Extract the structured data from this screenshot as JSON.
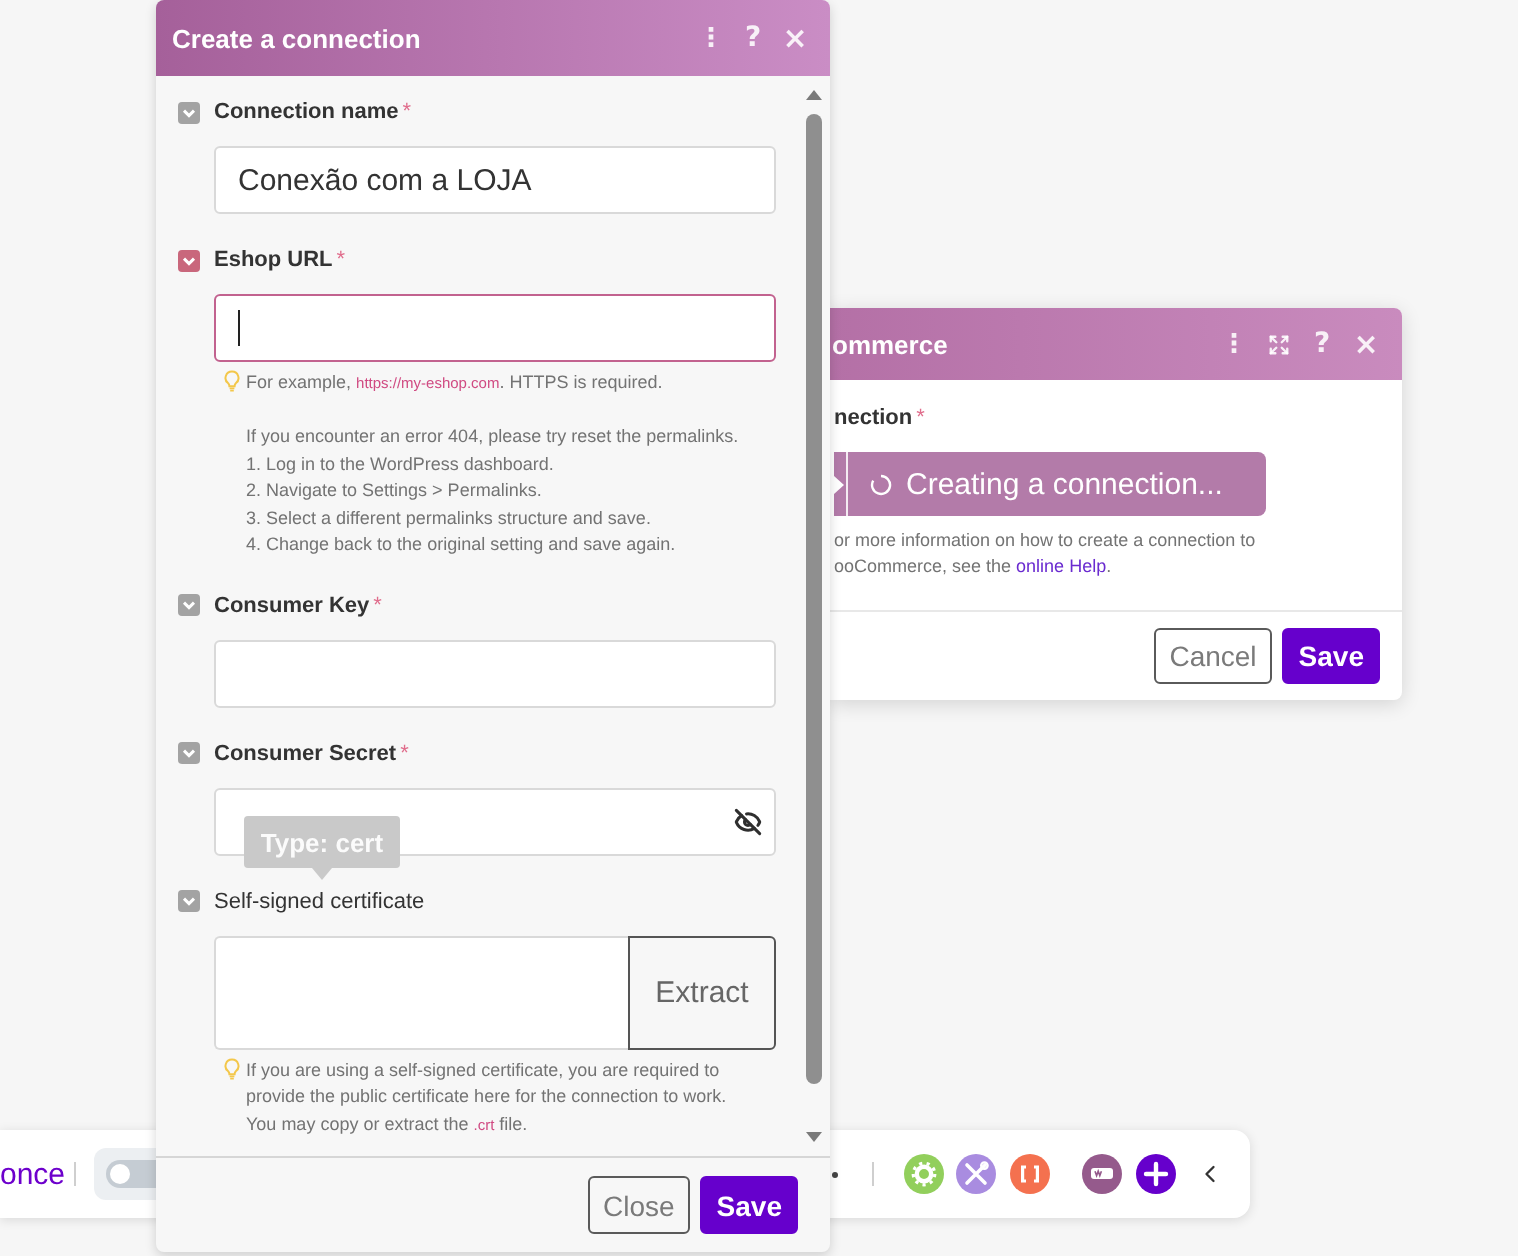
{
  "connection_dialog": {
    "title": "Create a connection",
    "header_buttons": [
      {
        "kind": "menu",
        "label": "⋮"
      },
      {
        "kind": "help",
        "label": "?"
      },
      {
        "kind": "close",
        "label": "×"
      }
    ],
    "fields": [
      {
        "kind": "text",
        "label": "Connection name",
        "required_mark": "*",
        "value": "Conexão com a LOJA",
        "error": false,
        "focused": false
      },
      {
        "kind": "text",
        "label": "Eshop URL",
        "required_mark": "*",
        "error": true,
        "focused": true,
        "hint": {
          "paragraphs": [
            {
              "lines": [
                [
                  {
                    "text": "For example, "
                  },
                  {
                    "kind": "link",
                    "text": "https://my-eshop.com"
                  },
                  {
                    "text": ". HTTPS is required."
                  }
                ]
              ]
            },
            {
              "lines": [
                [
                  {
                    "text": "If you encounter an error 404, please try reset the permalinks."
                  }
                ],
                [
                  {
                    "text": "1. Log in to the WordPress dashboard."
                  }
                ],
                [
                  {
                    "text": "2. Navigate to Settings > Permalinks."
                  }
                ],
                [
                  {
                    "text": "3. Select a different permalinks structure and save."
                  }
                ],
                [
                  {
                    "text": "4. Change back to the original setting and save again."
                  }
                ]
              ]
            }
          ]
        }
      },
      {
        "kind": "text",
        "label": "Consumer Key",
        "required_mark": "*",
        "error": false,
        "focused": false
      },
      {
        "kind": "password",
        "label": "Consumer Secret",
        "required_mark": "*",
        "error": false,
        "focused": false
      },
      {
        "kind": "certificate",
        "label": "Self-signed certificate",
        "error": false,
        "focused": false,
        "button": "Extract",
        "hint": {
          "paragraphs": [
            {
              "lines": [
                [
                  {
                    "text": "If you are using a self-signed certificate, you are required to"
                  }
                ],
                [
                  {
                    "text": "provide the public certificate here for the connection to work."
                  }
                ],
                [
                  {
                    "text": "You may copy or extract the "
                  },
                  {
                    "kind": "link",
                    "text": ".crt"
                  },
                  {
                    "text": " file."
                  }
                ]
              ]
            }
          ]
        }
      }
    ],
    "tooltip": "Type: cert",
    "buttons": [
      {
        "kind": "secondary",
        "label": "Close"
      },
      {
        "kind": "primary",
        "label": "Save"
      }
    ]
  },
  "module_dialog": {
    "title": "ommerce",
    "header_buttons": [
      {
        "kind": "menu",
        "label": "⋮"
      },
      {
        "kind": "expand"
      },
      {
        "kind": "help",
        "label": "?"
      },
      {
        "kind": "close",
        "label": "×"
      }
    ],
    "field": {
      "label": "nection",
      "required_mark": "*",
      "status": "Creating a connection...",
      "loading": true
    },
    "help": {
      "lines": [
        [
          {
            "text": "or more information on how to create a connection to"
          }
        ],
        [
          {
            "text": "ooCommerce, see the "
          },
          {
            "kind": "link",
            "text": "online Help"
          },
          {
            "text": "."
          }
        ]
      ]
    },
    "buttons": [
      {
        "kind": "secondary",
        "label": "Cancel"
      },
      {
        "kind": "primary",
        "label": "Save"
      }
    ]
  },
  "scenario_toolbar": {
    "run_label": "once",
    "schedule_switch": {
      "on": false
    }
  }
}
